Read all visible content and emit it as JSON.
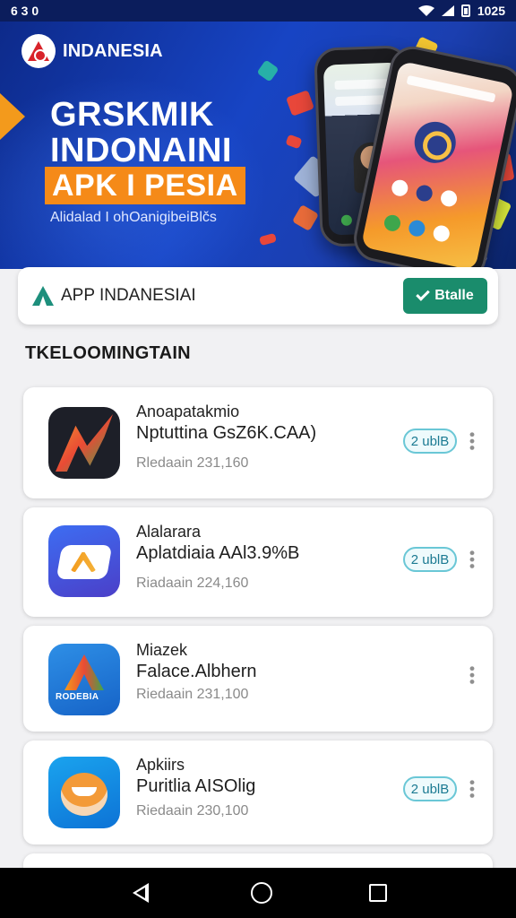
{
  "status_bar": {
    "left_text": "6 3 0",
    "time": "1025"
  },
  "banner": {
    "brand": "INDANESIA",
    "headline_line1": "GRSKMIK",
    "headline_line2": "INDONAINI",
    "headline_box": "APK I PESIA",
    "subtitle": "Alidalad I ohOanigibeiBlčs"
  },
  "app_bar": {
    "title": "APP  INDANESIAI",
    "install_label": "Btalle"
  },
  "section": {
    "title": "TKELOOMINGTAIN"
  },
  "apps": [
    {
      "name": "Anoapatakmio",
      "desc": "Nptuttina GsZ6K.CAA)",
      "meta": "Rledaain 231,160",
      "badge": "2 ublB",
      "icon": "colorful-stroke-logo-icon"
    },
    {
      "name": "Alalarara",
      "desc": "Aplatdiaia AAl3.9%B",
      "meta": "Riadaain 224,160",
      "badge": "2 ublB",
      "icon": "ap-logo-icon"
    },
    {
      "name": "Miazek",
      "desc": "Falace.Albhern",
      "meta": "Riedaain 231,100",
      "badge": "",
      "icon": "rodebia-logo-icon"
    },
    {
      "name": "Apkiirs",
      "desc": "Puritlia AISOlig",
      "meta": "Riedaain 230,100",
      "badge": "2 ublB",
      "icon": "mascot-icon"
    }
  ],
  "nav": {
    "back": "back-icon",
    "home": "home-icon",
    "recents": "recents-icon"
  }
}
